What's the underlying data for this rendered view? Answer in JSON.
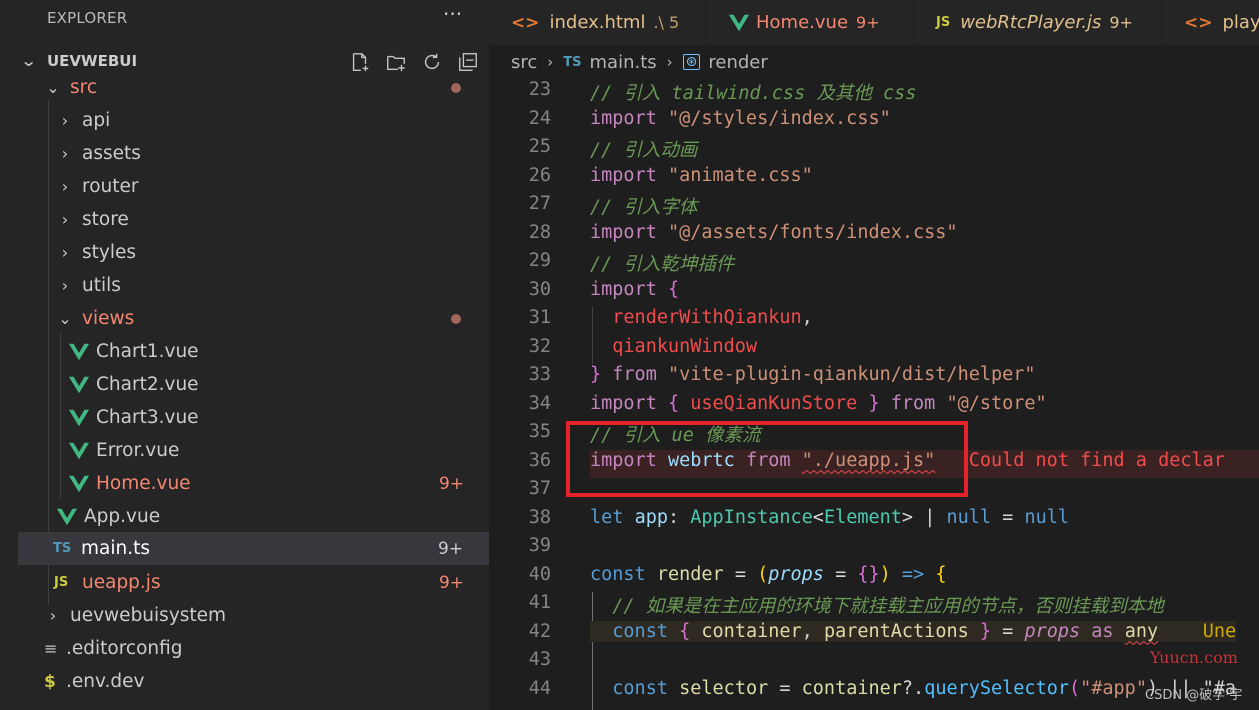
{
  "explorer": {
    "header": "EXPLORER",
    "more_icon": "ellipsis-icon",
    "section_title": "UEVWEBUI",
    "actions": [
      "new-file-icon",
      "new-folder-icon",
      "refresh-icon",
      "collapse-all-icon"
    ]
  },
  "tree": [
    {
      "label": "src",
      "kind": "folder-open",
      "status": "err",
      "dot": true
    },
    {
      "label": "api",
      "kind": "folder"
    },
    {
      "label": "assets",
      "kind": "folder"
    },
    {
      "label": "router",
      "kind": "folder"
    },
    {
      "label": "store",
      "kind": "folder"
    },
    {
      "label": "styles",
      "kind": "folder"
    },
    {
      "label": "utils",
      "kind": "folder"
    },
    {
      "label": "views",
      "kind": "folder-open",
      "status": "err",
      "dot": true
    },
    {
      "label": "Chart1.vue",
      "kind": "vue"
    },
    {
      "label": "Chart2.vue",
      "kind": "vue"
    },
    {
      "label": "Chart3.vue",
      "kind": "vue"
    },
    {
      "label": "Error.vue",
      "kind": "vue"
    },
    {
      "label": "Home.vue",
      "kind": "vue",
      "status": "err",
      "badge": "9+"
    },
    {
      "label": "App.vue",
      "kind": "vue"
    },
    {
      "label": "main.ts",
      "kind": "ts",
      "badge": "9+",
      "selected": true
    },
    {
      "label": "ueapp.js",
      "kind": "js",
      "status": "err",
      "badge": "9+"
    },
    {
      "label": "uevwebuisystem",
      "kind": "folder"
    },
    {
      "label": ".editorconfig",
      "kind": "config"
    },
    {
      "label": ".env.dev",
      "kind": "env"
    }
  ],
  "tabs": [
    {
      "icon": "<>",
      "name": "index.html",
      "suffix": ".\\ 5",
      "status": "warn"
    },
    {
      "icon": "V",
      "name": "Home.vue",
      "suffix": "9+",
      "status": "err"
    },
    {
      "icon": "JS",
      "name": "webRtcPlayer.js",
      "suffix": "9+",
      "status": "warn"
    },
    {
      "icon": "<>",
      "name": "player",
      "suffix": "",
      "status": "warn"
    }
  ],
  "breadcrumb": {
    "folder": "src",
    "file_icon": "TS",
    "file": "main.ts",
    "symbol_icon": "symbol-method-icon",
    "symbol": "render"
  },
  "line_numbers": [
    "23",
    "24",
    "25",
    "26",
    "27",
    "28",
    "29",
    "30",
    "31",
    "32",
    "33",
    "34",
    "35",
    "36",
    "37",
    "38",
    "39",
    "40",
    "41",
    "42",
    "43",
    "44"
  ],
  "code": {
    "l23": "// 引入 tailwind.css 及其他 css",
    "l24_kw": "import",
    "l24_str": "\"@/styles/index.css\"",
    "l25": "// 引入动画",
    "l26_kw": "import",
    "l26_str": "\"animate.css\"",
    "l27": "// 引入字体",
    "l28_kw": "import",
    "l28_str": "\"@/assets/fonts/index.css\"",
    "l29": "// 引入乾坤插件",
    "l30_kw": "import",
    "l30_br": "{",
    "l31": "renderWithQiankun",
    "l31_comma": ",",
    "l32": "qiankunWindow",
    "l33_br": "}",
    "l33_kw": "from",
    "l33_str": "\"vite-plugin-qiankun/dist/helper\"",
    "l34_kw": "import",
    "l34_open": "{",
    "l34_var": "useQianKunStore",
    "l34_close": "}",
    "l34_from": "from",
    "l34_str": "\"@/store\"",
    "l35": "// 引入 ue 像素流",
    "l36_kw": "import",
    "l36_var": "webrtc",
    "l36_from": "from",
    "l36_str": "\"./ueapp.js\"",
    "l36_err": "Could not find a declar",
    "l38_let": "let",
    "l38_var": "app",
    "l38_colon": ":",
    "l38_type": "AppInstance",
    "l38_lt": "<",
    "l38_type2": "Element",
    "l38_gt": ">",
    "l38_pipe": "|",
    "l38_null": "null",
    "l38_eq": "=",
    "l38_null2": "null",
    "l40_const": "const",
    "l40_fn": "render",
    "l40_eq": "=",
    "l40_open": "(",
    "l40_param": "props",
    "l40_eq2": "=",
    "l40_obj": "{}",
    "l40_close": ")",
    "l40_arrow": "=>",
    "l40_brace": "{",
    "l41": "// 如果是在主应用的环境下就挂载主应用的节点，否则挂载到本地",
    "l42_const": "const",
    "l42_open": "{",
    "l42_a": "container",
    "l42_comma": ",",
    "l42_b": "parentActions",
    "l42_close": "}",
    "l42_eq": "=",
    "l42_props": "props",
    "l42_as": "as",
    "l42_any": "any",
    "l42_err": "Une",
    "l44_const": "const",
    "l44_var": "selector",
    "l44_eq": "=",
    "l44_obj": "container",
    "l44_opt": "?.",
    "l44_fn": "querySelector",
    "l44_open": "(",
    "l44_str": "\"#app\"",
    "l44_rest": ") || \"#a"
  },
  "colors": {
    "error": "#f48771",
    "warning": "#e2c08d",
    "highlight_box": "#e5232b"
  },
  "watermark": {
    "site": "Yuucn.com",
    "credit": "CSDN @破学·宇"
  }
}
